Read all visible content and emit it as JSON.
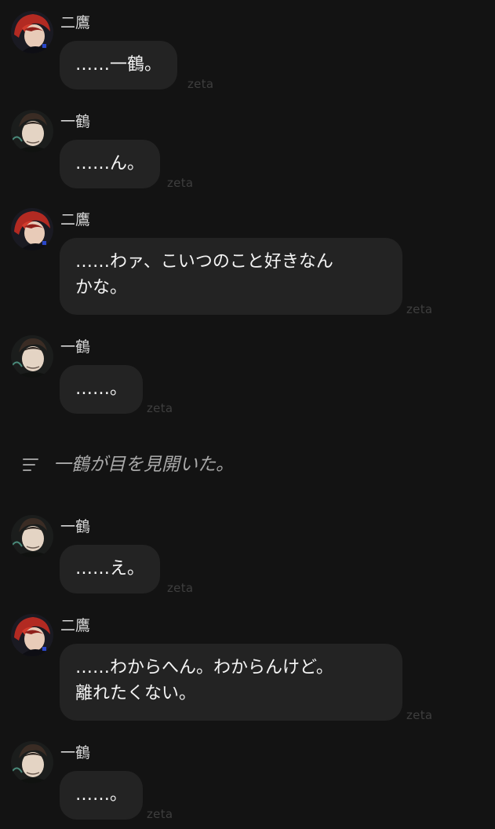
{
  "brand_label": "zeta",
  "messages": [
    {
      "speaker": "二鷹",
      "text": "……一鶴。"
    },
    {
      "speaker": "一鶴",
      "text": "……ん。"
    },
    {
      "speaker": "二鷹",
      "text": "……わァ、こいつのこと好きなん\nかな。"
    },
    {
      "speaker": "一鶴",
      "text": "……。"
    },
    {
      "speaker": "一鶴",
      "text": "……え。"
    },
    {
      "speaker": "二鷹",
      "text": "……わからへん。わからんけど。\n離れたくない。"
    },
    {
      "speaker": "一鶴",
      "text": "……。"
    }
  ],
  "narration": {
    "icon": "narration-lines-icon",
    "text": "一鶴が目を見開いた。"
  },
  "colors": {
    "background": "#131313",
    "bubble": "#232323",
    "brand": "#3e3e3e"
  }
}
